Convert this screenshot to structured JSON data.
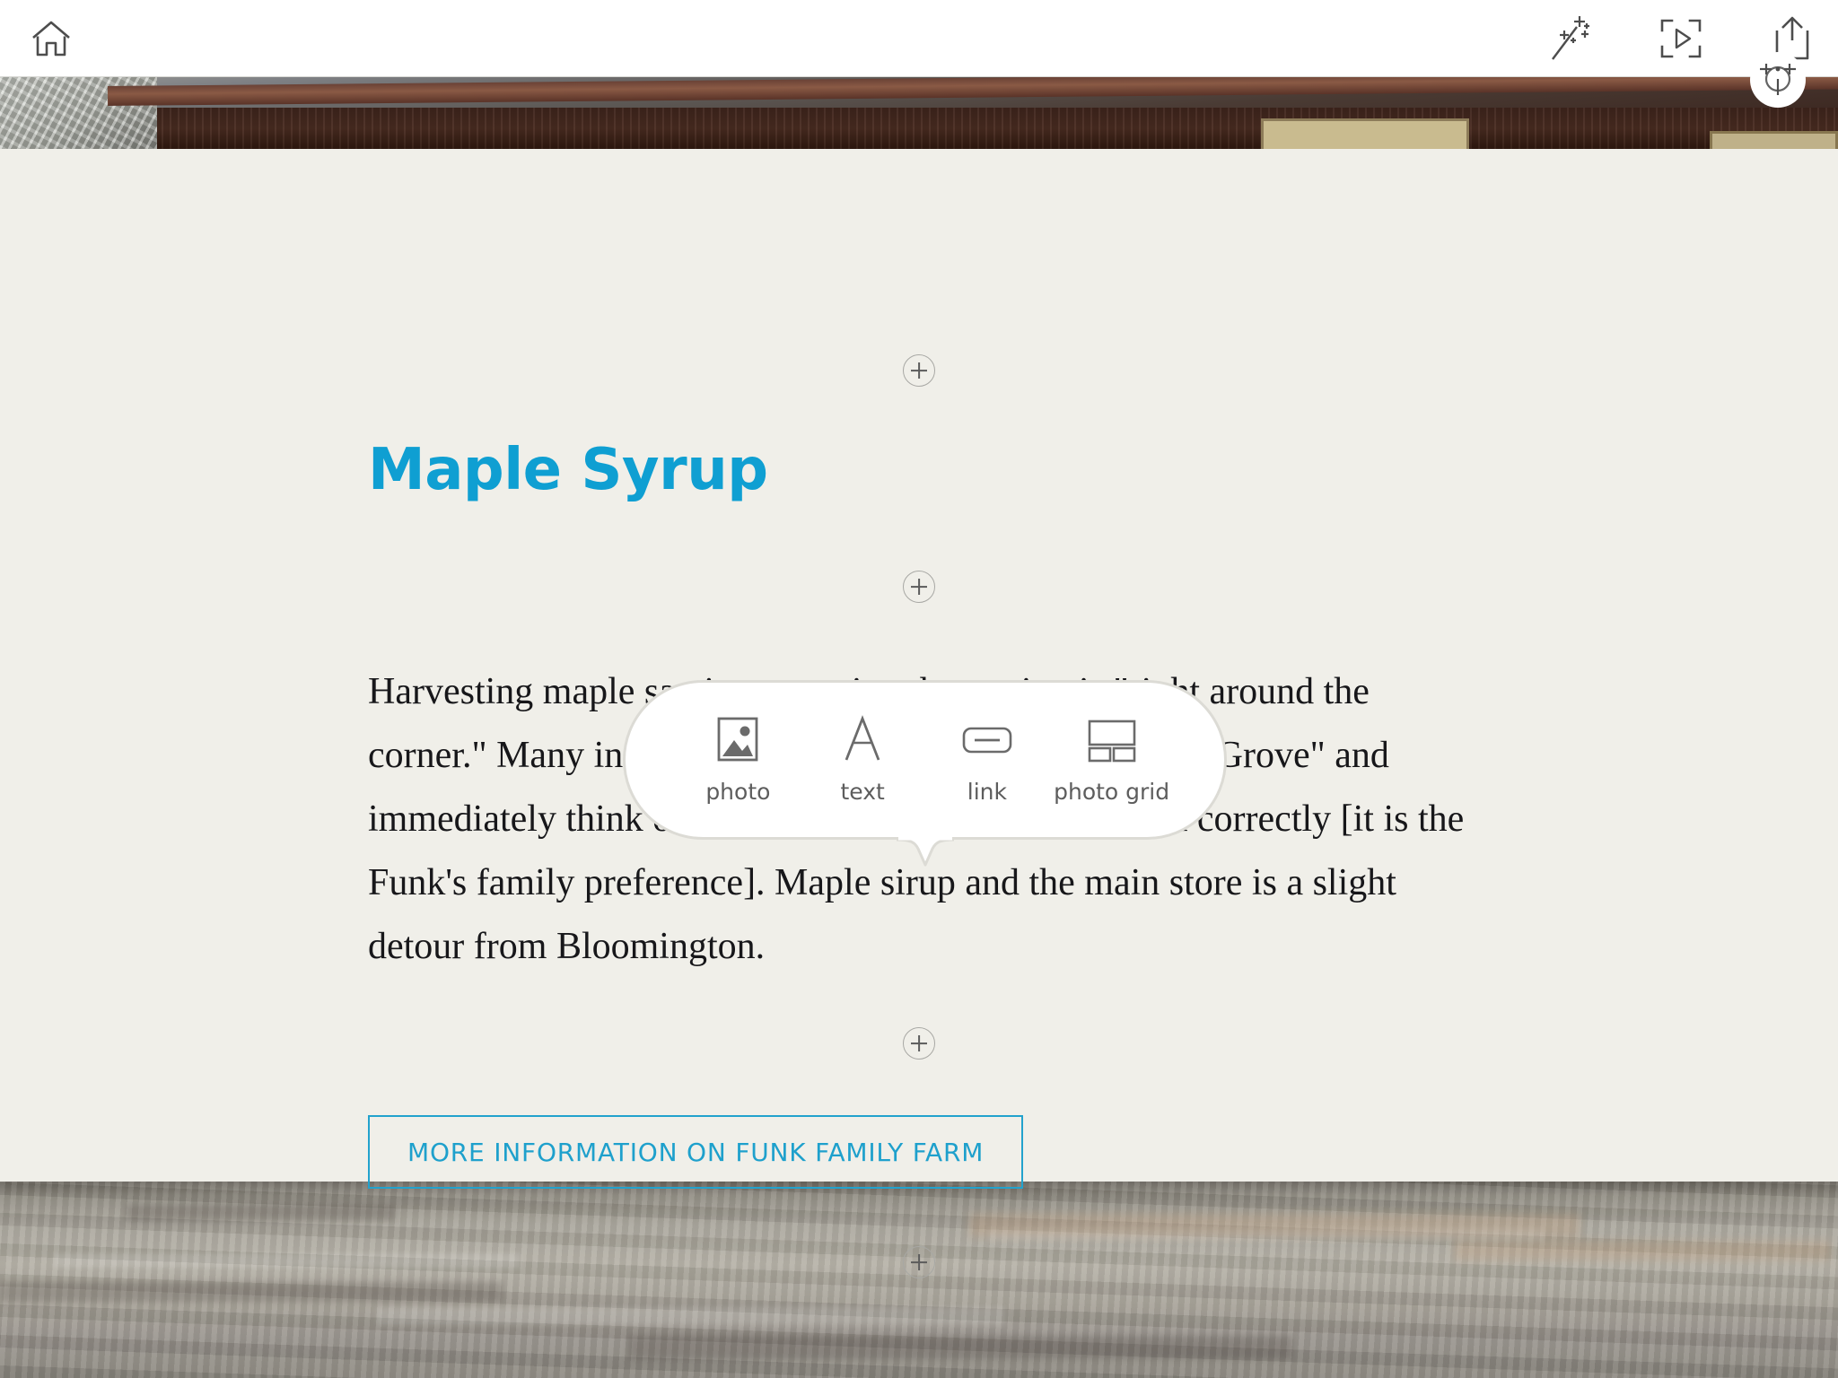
{
  "toolbar": {
    "home": {
      "label": "Home",
      "icon": "home-icon"
    },
    "theme": {
      "label": "Themes",
      "icon": "magic-wand-icon"
    },
    "preview": {
      "label": "Preview",
      "icon": "preview-play-icon"
    },
    "share": {
      "label": "Share",
      "icon": "share-upload-icon"
    },
    "focal_point": {
      "label": "Set focal point",
      "icon": "focal-point-crosshair-icon"
    }
  },
  "page": {
    "title": "Maple Syrup",
    "title_color": "#0f9fd2",
    "background_color": "#f0efe9",
    "body_text": "Harvesting maple sap is a sure sign that spring is \"right around the corner.\" Many in central Illinois hear the words \"Funk's Grove\" and immediately think of maple sirup. Yes, sirup is spelled correctly [it is the Funk's family preference]. Maple sirup and the main store is a slight detour from Bloomington.",
    "cta_label": "MORE INFORMATION ON FUNK FAMILY FARM",
    "cta_color": "#1ea0cc"
  },
  "insert_buttons": [
    {
      "name": "insert-above-title",
      "label": "+"
    },
    {
      "name": "insert-below-title",
      "label": "+"
    },
    {
      "name": "insert-active",
      "label": "+"
    },
    {
      "name": "insert-bottom",
      "label": "+"
    }
  ],
  "popover": {
    "visible": true,
    "items": [
      {
        "label": "photo",
        "icon": "photo-icon"
      },
      {
        "label": "text",
        "icon": "text-letter-a-icon"
      },
      {
        "label": "link",
        "icon": "link-button-icon"
      },
      {
        "label": "photo grid",
        "icon": "photo-grid-icon"
      }
    ]
  },
  "hero_image": {
    "alt": "Dark brown wooden barn with gray shingle roof",
    "name": "hero-photo"
  },
  "bottom_image": {
    "alt": "Gray gravel and dry grass ground",
    "name": "bottom-photo"
  }
}
